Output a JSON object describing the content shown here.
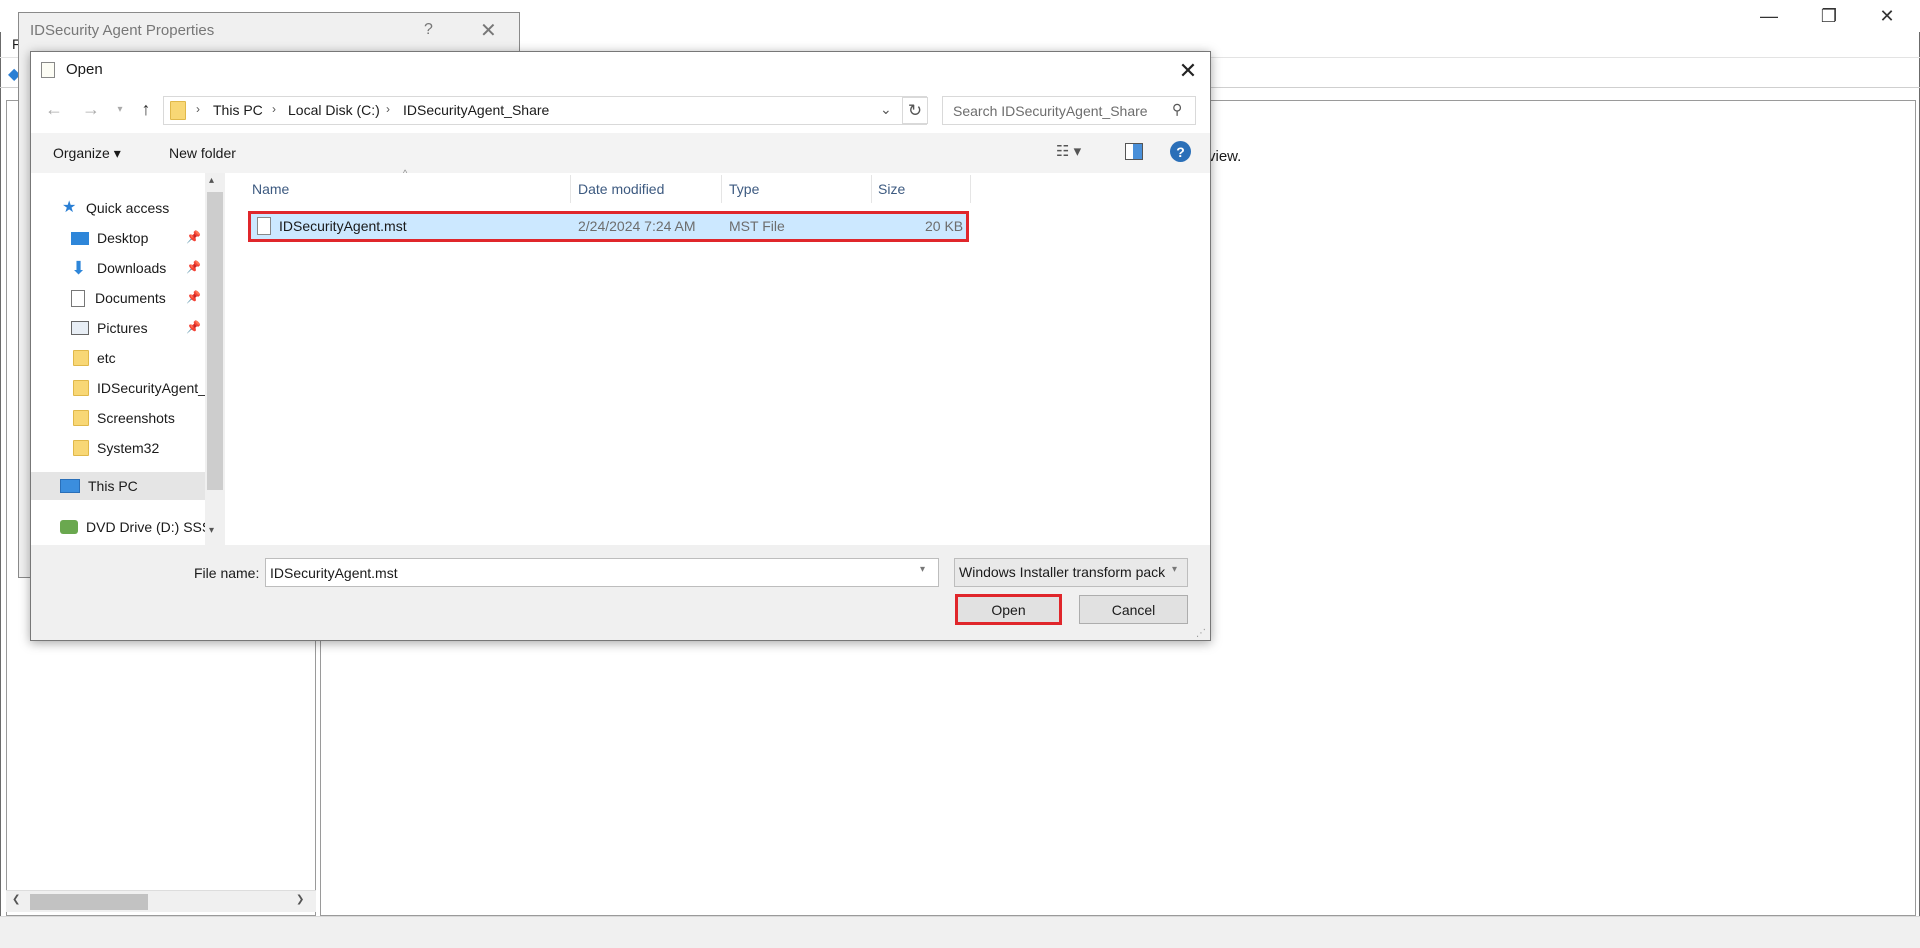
{
  "bg_window": {
    "controls": [
      "—",
      "❐",
      "✕"
    ],
    "menu_first": "F",
    "text_fragment": "view."
  },
  "props_dialog": {
    "title": "IDSecurity Agent Properties",
    "help": "?",
    "close": "✕"
  },
  "open_dialog": {
    "title": "Open",
    "close": "✕",
    "address": {
      "crumbs": [
        "This PC",
        "Local Disk (C:)",
        "IDSecurityAgent_Share"
      ],
      "separator": "›"
    },
    "search": {
      "placeholder": "Search IDSecurityAgent_Share"
    },
    "toolbar": {
      "organize": "Organize ▾",
      "new_folder": "New folder",
      "help": "?"
    },
    "nav": {
      "quick_access": "Quick access",
      "items": [
        "Desktop",
        "Downloads",
        "Documents",
        "Pictures",
        "etc",
        "IDSecurityAgent_",
        "Screenshots",
        "System32"
      ],
      "this_pc": "This PC",
      "dvd": "DVD Drive (D:) SSS_"
    },
    "columns": [
      "Name",
      "Date modified",
      "Type",
      "Size"
    ],
    "files": [
      {
        "name": "IDSecurityAgent.mst",
        "date": "2/24/2024 7:24 AM",
        "type": "MST File",
        "size": "20 KB"
      }
    ],
    "file_name_label": "File name:",
    "file_name_value": "IDSecurityAgent.mst",
    "file_type": "Windows Installer transform package",
    "open_button": "Open",
    "cancel_button": "Cancel"
  },
  "colors": {
    "highlight": "#e0262b",
    "selection": "#cce8ff",
    "link": "#3d5a80"
  }
}
